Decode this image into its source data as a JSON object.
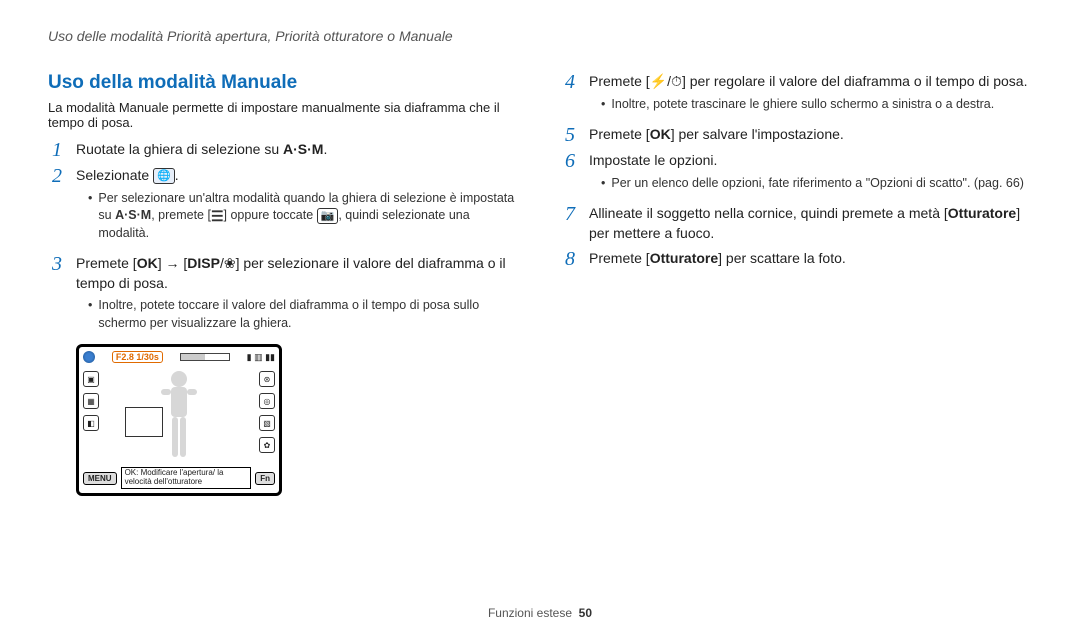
{
  "header": "Uso delle modalità Priorità apertura, Priorità otturatore o Manuale",
  "title": "Uso della modalità Manuale",
  "lead": "La modalità Manuale permette di impostare manualmente sia diaframma che il tempo di posa.",
  "left": {
    "step1": {
      "n": "1",
      "t1": "Ruotate la ghiera di selezione su ",
      "asm": "A·S·M",
      "t2": "."
    },
    "step2": {
      "n": "2",
      "t1": "Selezionate ",
      "bullet_a": "Per selezionare un'altra modalità quando la ghiera di selezione è impostata su ",
      "asm": "A·S·M",
      "bullet_b": ", premete [",
      "menu_icon": "☰",
      "bullet_c": "] oppure toccate ",
      "cam_icon": "📷",
      "bullet_d": ", quindi selezionate una modalità."
    },
    "step3": {
      "n": "3",
      "t1": "Premete [",
      "ok": "OK",
      "t2": "] → [",
      "disp": "DISP",
      "flower": "❀",
      "t3": "] per selezionare il valore del diaframma o il tempo di posa.",
      "bullet": "Inoltre, potete toccare il valore del diaframma o il tempo di posa sullo schermo per visualizzare la ghiera."
    }
  },
  "illustration": {
    "fvalue": "F2.8 1/30s",
    "caption": "OK: Modificare l'apertura/\nla velocità dell'otturatore",
    "menu": "MENU",
    "fn": "Fn"
  },
  "right": {
    "step4": {
      "n": "4",
      "t1": "Premete [",
      "flash": "⚡",
      "timer": "⏱",
      "t2": "] per regolare il valore del diaframma o il tempo di posa.",
      "bullet": "Inoltre, potete trascinare le ghiere sullo schermo a sinistra o a destra."
    },
    "step5": {
      "n": "5",
      "t1": "Premete [",
      "ok": "OK",
      "t2": "] per salvare l'impostazione."
    },
    "step6": {
      "n": "6",
      "t1": "Impostate le opzioni.",
      "bullet": "Per un elenco delle opzioni, fate riferimento a \"Opzioni di scatto\". (pag. 66)"
    },
    "step7": {
      "n": "7",
      "t1": "Allineate il soggetto nella cornice, quindi premete a metà [",
      "bold": "Otturatore",
      "t2": "] per mettere a fuoco."
    },
    "step8": {
      "n": "8",
      "t1": "Premete [",
      "bold": "Otturatore",
      "t2": "] per scattare la foto."
    }
  },
  "footer": {
    "section": "Funzioni estese",
    "page": "50"
  }
}
